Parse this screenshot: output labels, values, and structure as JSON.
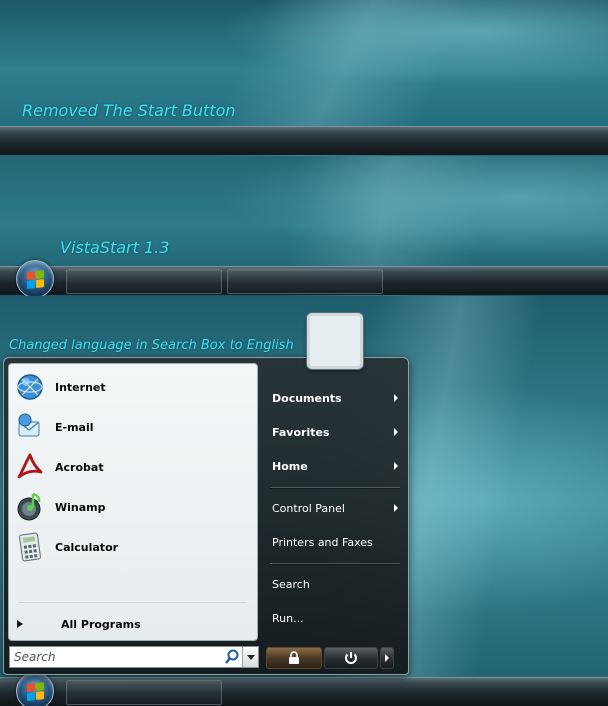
{
  "captions": {
    "panel1": "Removed The Start Button",
    "panel2": "VistaStart 1.3",
    "panel3": "Changed language in Search Box to English"
  },
  "start_menu": {
    "pinned": [
      {
        "label": "Internet",
        "icon": "internet-icon"
      },
      {
        "label": "E-mail",
        "icon": "email-icon"
      },
      {
        "label": "Acrobat",
        "icon": "acrobat-icon"
      },
      {
        "label": "Winamp",
        "icon": "winamp-icon"
      },
      {
        "label": "Calculator",
        "icon": "calculator-icon"
      }
    ],
    "all_programs": "All Programs",
    "search_placeholder": "Search",
    "right_items": [
      {
        "label": "Documents",
        "submenu": true
      },
      {
        "label": "Favorites",
        "submenu": true
      },
      {
        "label": "Home",
        "submenu": true
      },
      {
        "label": "Control Panel",
        "submenu": true
      },
      {
        "label": "Printers and Faxes",
        "submenu": false
      },
      {
        "label": "Search",
        "submenu": false
      },
      {
        "label": "Run...",
        "submenu": false
      }
    ],
    "power_icons": [
      "lock-icon",
      "power-icon",
      "arrow-right-icon"
    ]
  },
  "colors": {
    "caption": "#3fe0f0",
    "orb_accent": "#2b5c86"
  }
}
